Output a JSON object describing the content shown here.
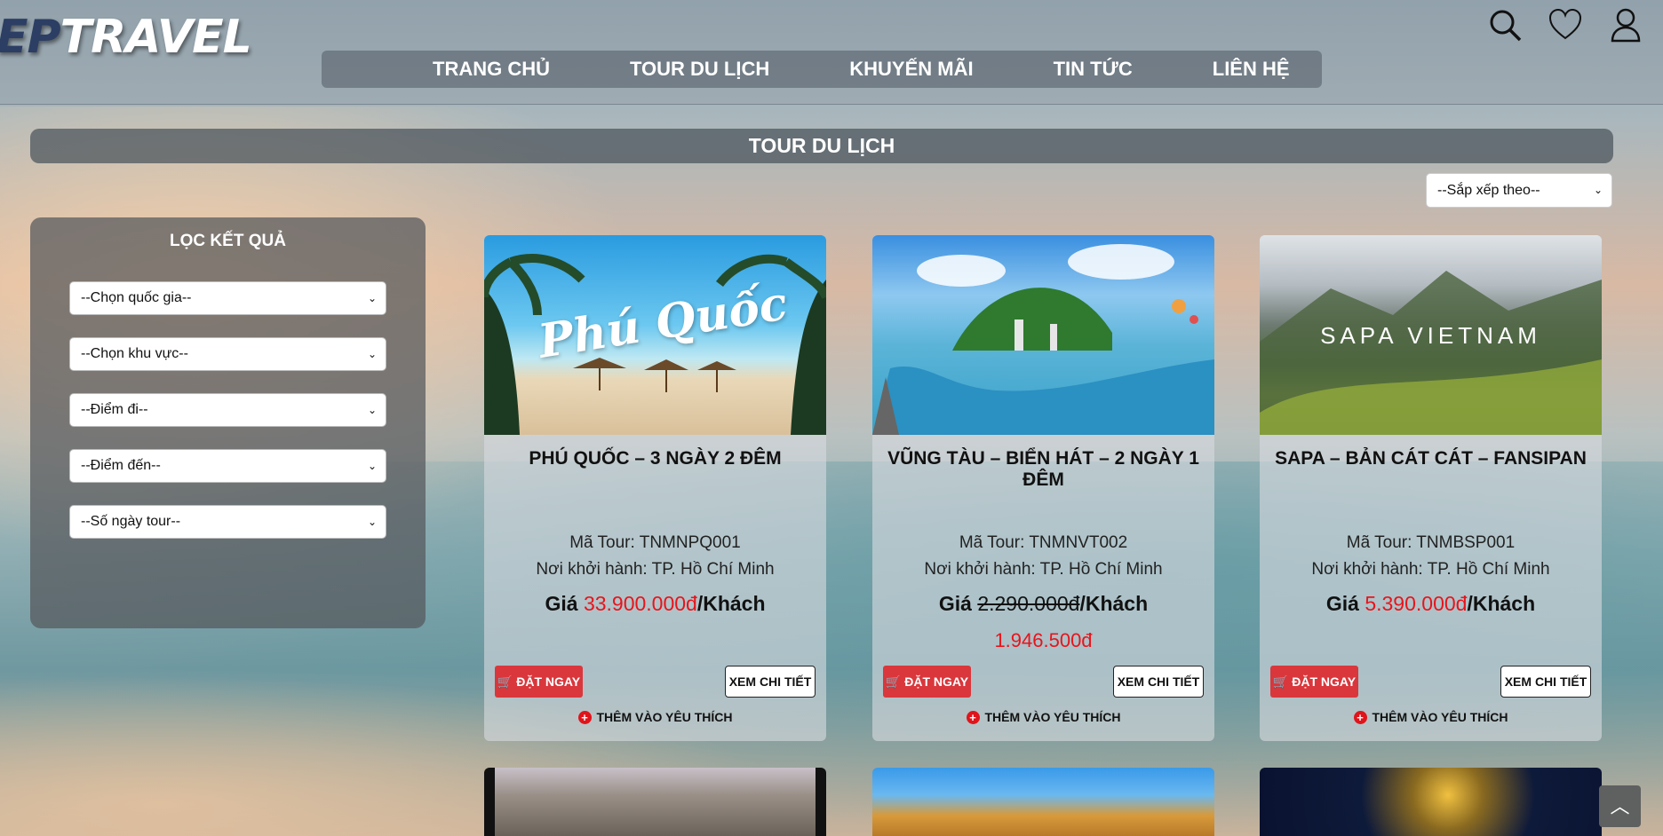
{
  "header": {
    "logo_part1": "EP",
    "logo_part2": "TRAVEL",
    "nav": [
      "TRANG CHỦ",
      "TOUR DU LỊCH",
      "KHUYẾN MÃI",
      "TIN TỨC",
      "LIÊN HỆ"
    ],
    "icons": [
      "search-icon",
      "heart-icon",
      "user-icon"
    ]
  },
  "page_title": "TOUR DU LỊCH",
  "sort": {
    "selected": "--Sắp xếp theo--"
  },
  "filters": {
    "title": "LỌC KẾT QUẢ",
    "selects": [
      "--Chọn quốc gia--",
      "--Chọn khu vực--",
      "--Điểm đi--",
      "--Điểm đến--",
      "--Số ngày tour--"
    ]
  },
  "tours": [
    {
      "title": "PHÚ QUỐC – 3 NGÀY 2 ĐÊM",
      "code": "Mã Tour: TNMNPQ001",
      "departure": "Nơi khởi hành: TP. Hồ Chí Minh",
      "price_label": "Giá",
      "price": "33.900.000đ",
      "price_unit": "/Khách",
      "sale_price": "",
      "image_text": "Phú Quốc"
    },
    {
      "title": "VŨNG TÀU – BIỂN HÁT – 2 NGÀY 1 ĐÊM",
      "code": "Mã Tour: TNMNVT002",
      "departure": "Nơi khởi hành: TP. Hồ Chí Minh",
      "price_label": "Giá",
      "price": "2.290.000đ",
      "price_unit": "/Khách",
      "sale_price": "1.946.500đ",
      "image_text": ""
    },
    {
      "title": "SAPA – BẢN CÁT CÁT – FANSIPAN",
      "code": "Mã Tour: TNMBSP001",
      "departure": "Nơi khởi hành: TP. Hồ Chí Minh",
      "price_label": "Giá",
      "price": "5.390.000đ",
      "price_unit": "/Khách",
      "sale_price": "",
      "image_text": "SAPA VIETNAM"
    }
  ],
  "buttons": {
    "book": "ĐẶT NGAY",
    "detail": "XEM CHI TIẾT",
    "favorite": "THÊM VÀO YÊU THÍCH"
  },
  "colors": {
    "price_red": "#e8141b",
    "book_button": "#d9373c",
    "nav_bar": "#505a64"
  }
}
